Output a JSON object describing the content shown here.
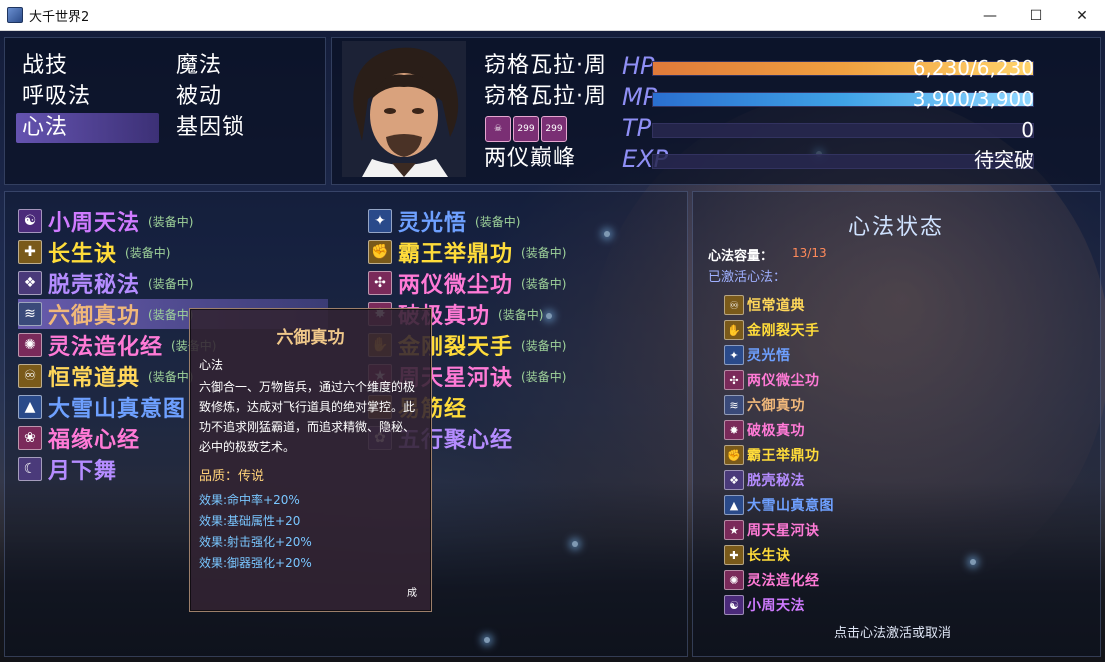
{
  "window": {
    "title": "大千世界2",
    "minimize": "—",
    "maximize": "☐",
    "close": "✕"
  },
  "menu": {
    "items": [
      {
        "label": "战技"
      },
      {
        "label": "魔法"
      },
      {
        "label": "呼吸法"
      },
      {
        "label": "被动"
      },
      {
        "label": "心法"
      },
      {
        "label": "基因锁"
      }
    ],
    "selected": "心法"
  },
  "status": {
    "name1": "窃格瓦拉·周",
    "name2": "窃格瓦拉·周",
    "realm": "两仪巅峰",
    "hp": {
      "label": "HP",
      "value": "6,230/6,230",
      "ratio": 1.0,
      "color": "#f0a040"
    },
    "mp": {
      "label": "MP",
      "value": "3,900/3,900",
      "ratio": 1.0,
      "color": "#3fa2e6"
    },
    "tp": {
      "label": "TP",
      "value": "0",
      "ratio": 0
    },
    "exp": {
      "label": "EXP",
      "value": "待突破",
      "ratio": 0
    },
    "state_icons": [
      {
        "icon": "demon-face-icon",
        "text": ""
      },
      {
        "icon": "buff-icon",
        "text": "299"
      },
      {
        "icon": "buff-icon",
        "text": "299"
      }
    ]
  },
  "skills": {
    "equipped_tag": "(装备中)",
    "col1": [
      {
        "name": "小周天法",
        "color": "#d07bff",
        "tag": true,
        "icon": "meditation-icon"
      },
      {
        "name": "长生诀",
        "color": "#ffdc3a",
        "tag": true,
        "icon": "longevity-icon"
      },
      {
        "name": "脱壳秘法",
        "color": "#b58cff",
        "tag": true,
        "icon": "shell-icon"
      },
      {
        "name": "六御真功",
        "color": "#f0b87a",
        "tag": true,
        "icon": "wind-icon"
      },
      {
        "name": "灵法造化经",
        "color": "#ff7ad6",
        "tag": true,
        "icon": "spiral-icon"
      },
      {
        "name": "恒常道典",
        "color": "#ffd75a",
        "tag": true,
        "icon": "dao-icon"
      },
      {
        "name": "大雪山真意图",
        "color": "#6ea0ff",
        "tag": false,
        "icon": "mountain-icon"
      },
      {
        "name": "福缘心经",
        "color": "#ff7ad6",
        "tag": false,
        "icon": "fortune-icon"
      },
      {
        "name": "月下舞",
        "color": "#b58cff",
        "tag": false,
        "icon": "dance-icon"
      }
    ],
    "col2": [
      {
        "name": "灵光悟",
        "color": "#6ea0ff",
        "tag": true,
        "icon": "light-icon"
      },
      {
        "name": "霸王举鼎功",
        "color": "#ffdc3a",
        "tag": true,
        "icon": "strength-icon"
      },
      {
        "name": "两仪微尘功",
        "color": "#ff7ad6",
        "tag": true,
        "icon": "dust-icon"
      },
      {
        "name": "破极真功",
        "color": "#ff7ad6",
        "tag": true,
        "icon": "break-icon"
      },
      {
        "name": "金刚裂天手",
        "color": "#ffdc3a",
        "tag": true,
        "icon": "palm-icon"
      },
      {
        "name": "周天星河诀",
        "color": "#ff7ad6",
        "tag": true,
        "icon": "star-icon"
      },
      {
        "name": "易筋经",
        "color": "#ffdc3a",
        "tag": false,
        "icon": "sinew-icon"
      },
      {
        "name": "五行聚心经",
        "color": "#b58cff",
        "tag": false,
        "icon": "five-elements-icon"
      }
    ]
  },
  "tooltip": {
    "title": "六御真功",
    "type": "心法",
    "description": "六御合一、万物皆兵，通过六个维度的极致修炼，达成对飞行道具的绝对掌控。此功不追求刚猛霸道，而追求精微、隐秘、必中的极致艺术。",
    "quality": "品质：传说",
    "effects": [
      "效果:命中率+20%",
      "效果:基础属性+20",
      "效果:射击强化+20%",
      "效果:御器强化+20%"
    ],
    "corner": "成"
  },
  "right_panel": {
    "title": "心法状态",
    "capacity_label": "心法容量：",
    "capacity_value": "13/13",
    "active_label": "已激活心法：",
    "active": [
      {
        "name": "恒常道典",
        "color": "#ffd75a",
        "icon": "dao-icon"
      },
      {
        "name": "金刚裂天手",
        "color": "#ffdc3a",
        "icon": "palm-icon"
      },
      {
        "name": "灵光悟",
        "color": "#6ea0ff",
        "icon": "light-icon"
      },
      {
        "name": "两仪微尘功",
        "color": "#ff7ad6",
        "icon": "dust-icon"
      },
      {
        "name": "六御真功",
        "color": "#f0b87a",
        "icon": "wind-icon"
      },
      {
        "name": "破极真功",
        "color": "#ff7ad6",
        "icon": "break-icon"
      },
      {
        "name": "霸王举鼎功",
        "color": "#ffdc3a",
        "icon": "strength-icon"
      },
      {
        "name": "脱壳秘法",
        "color": "#b58cff",
        "icon": "shell-icon"
      },
      {
        "name": "大雪山真意图",
        "color": "#6ea0ff",
        "icon": "mountain-icon"
      },
      {
        "name": "周天星河诀",
        "color": "#ff7ad6",
        "icon": "star-icon"
      },
      {
        "name": "长生诀",
        "color": "#ffdc3a",
        "icon": "longevity-icon"
      },
      {
        "name": "灵法造化经",
        "color": "#ff7ad6",
        "icon": "spiral-icon"
      },
      {
        "name": "小周天法",
        "color": "#d07bff",
        "icon": "meditation-icon"
      }
    ],
    "hint": "点击心法激活或取消"
  }
}
